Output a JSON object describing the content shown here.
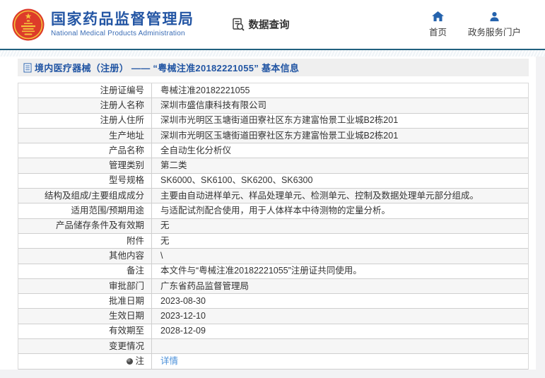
{
  "header": {
    "org_name_cn": "国家药品监督管理局",
    "org_name_en": "National Medical Products Administration",
    "data_query_label": "数据查询",
    "nav": [
      {
        "label": "首页",
        "icon": "home-icon"
      },
      {
        "label": "政务服务门户",
        "icon": "user-icon"
      }
    ],
    "logo_icon": "national-emblem"
  },
  "page": {
    "title": "境内医疗器械（注册） —— “粤械注准20182221055” 基本信息",
    "title_icon": "document-icon"
  },
  "table": {
    "rows": [
      {
        "label": "注册证编号",
        "value": "粤械注准20182221055"
      },
      {
        "label": "注册人名称",
        "value": "深圳市盛信康科技有限公司"
      },
      {
        "label": "注册人住所",
        "value": "深圳市光明区玉塘街道田寮社区东方建富怡景工业城B2栋201"
      },
      {
        "label": "生产地址",
        "value": "深圳市光明区玉塘街道田寮社区东方建富怡景工业城B2栋201"
      },
      {
        "label": "产品名称",
        "value": "全自动生化分析仪"
      },
      {
        "label": "管理类别",
        "value": "第二类"
      },
      {
        "label": "型号规格",
        "value": "SK6000、SK6100、SK6200、SK6300"
      },
      {
        "label": "结构及组成/主要组成成分",
        "value": "主要由自动进样单元、样品处理单元、检测单元、控制及数据处理单元部分组成。"
      },
      {
        "label": "适用范围/预期用途",
        "value": "与适配试剂配合使用，用于人体样本中待测物的定量分析。"
      },
      {
        "label": "产品储存条件及有效期",
        "value": "无"
      },
      {
        "label": "附件",
        "value": "无"
      },
      {
        "label": "其他内容",
        "value": "\\"
      },
      {
        "label": "备注",
        "value": "本文件与“粤械注准20182221055”注册证共同使用。"
      },
      {
        "label": "审批部门",
        "value": "广东省药品监督管理局"
      },
      {
        "label": "批准日期",
        "value": "2023-08-30"
      },
      {
        "label": "生效日期",
        "value": "2023-12-10"
      },
      {
        "label": "有效期至",
        "value": "2028-12-09"
      },
      {
        "label": "变更情况",
        "value": ""
      },
      {
        "label": "注",
        "value": "详情",
        "note_icon": "bulb-icon",
        "value_is_link": true
      }
    ]
  },
  "colors": {
    "brand_blue": "#2456a4",
    "nav_icon_blue": "#2563ad",
    "header_line_teal": "#21607e",
    "title_text_blue": "#2155a3",
    "link_blue": "#4a90d9",
    "row_alt_bg": "#f6f6f6",
    "emblem_red": "#dd3b2a",
    "emblem_gold": "#f5c33d"
  }
}
